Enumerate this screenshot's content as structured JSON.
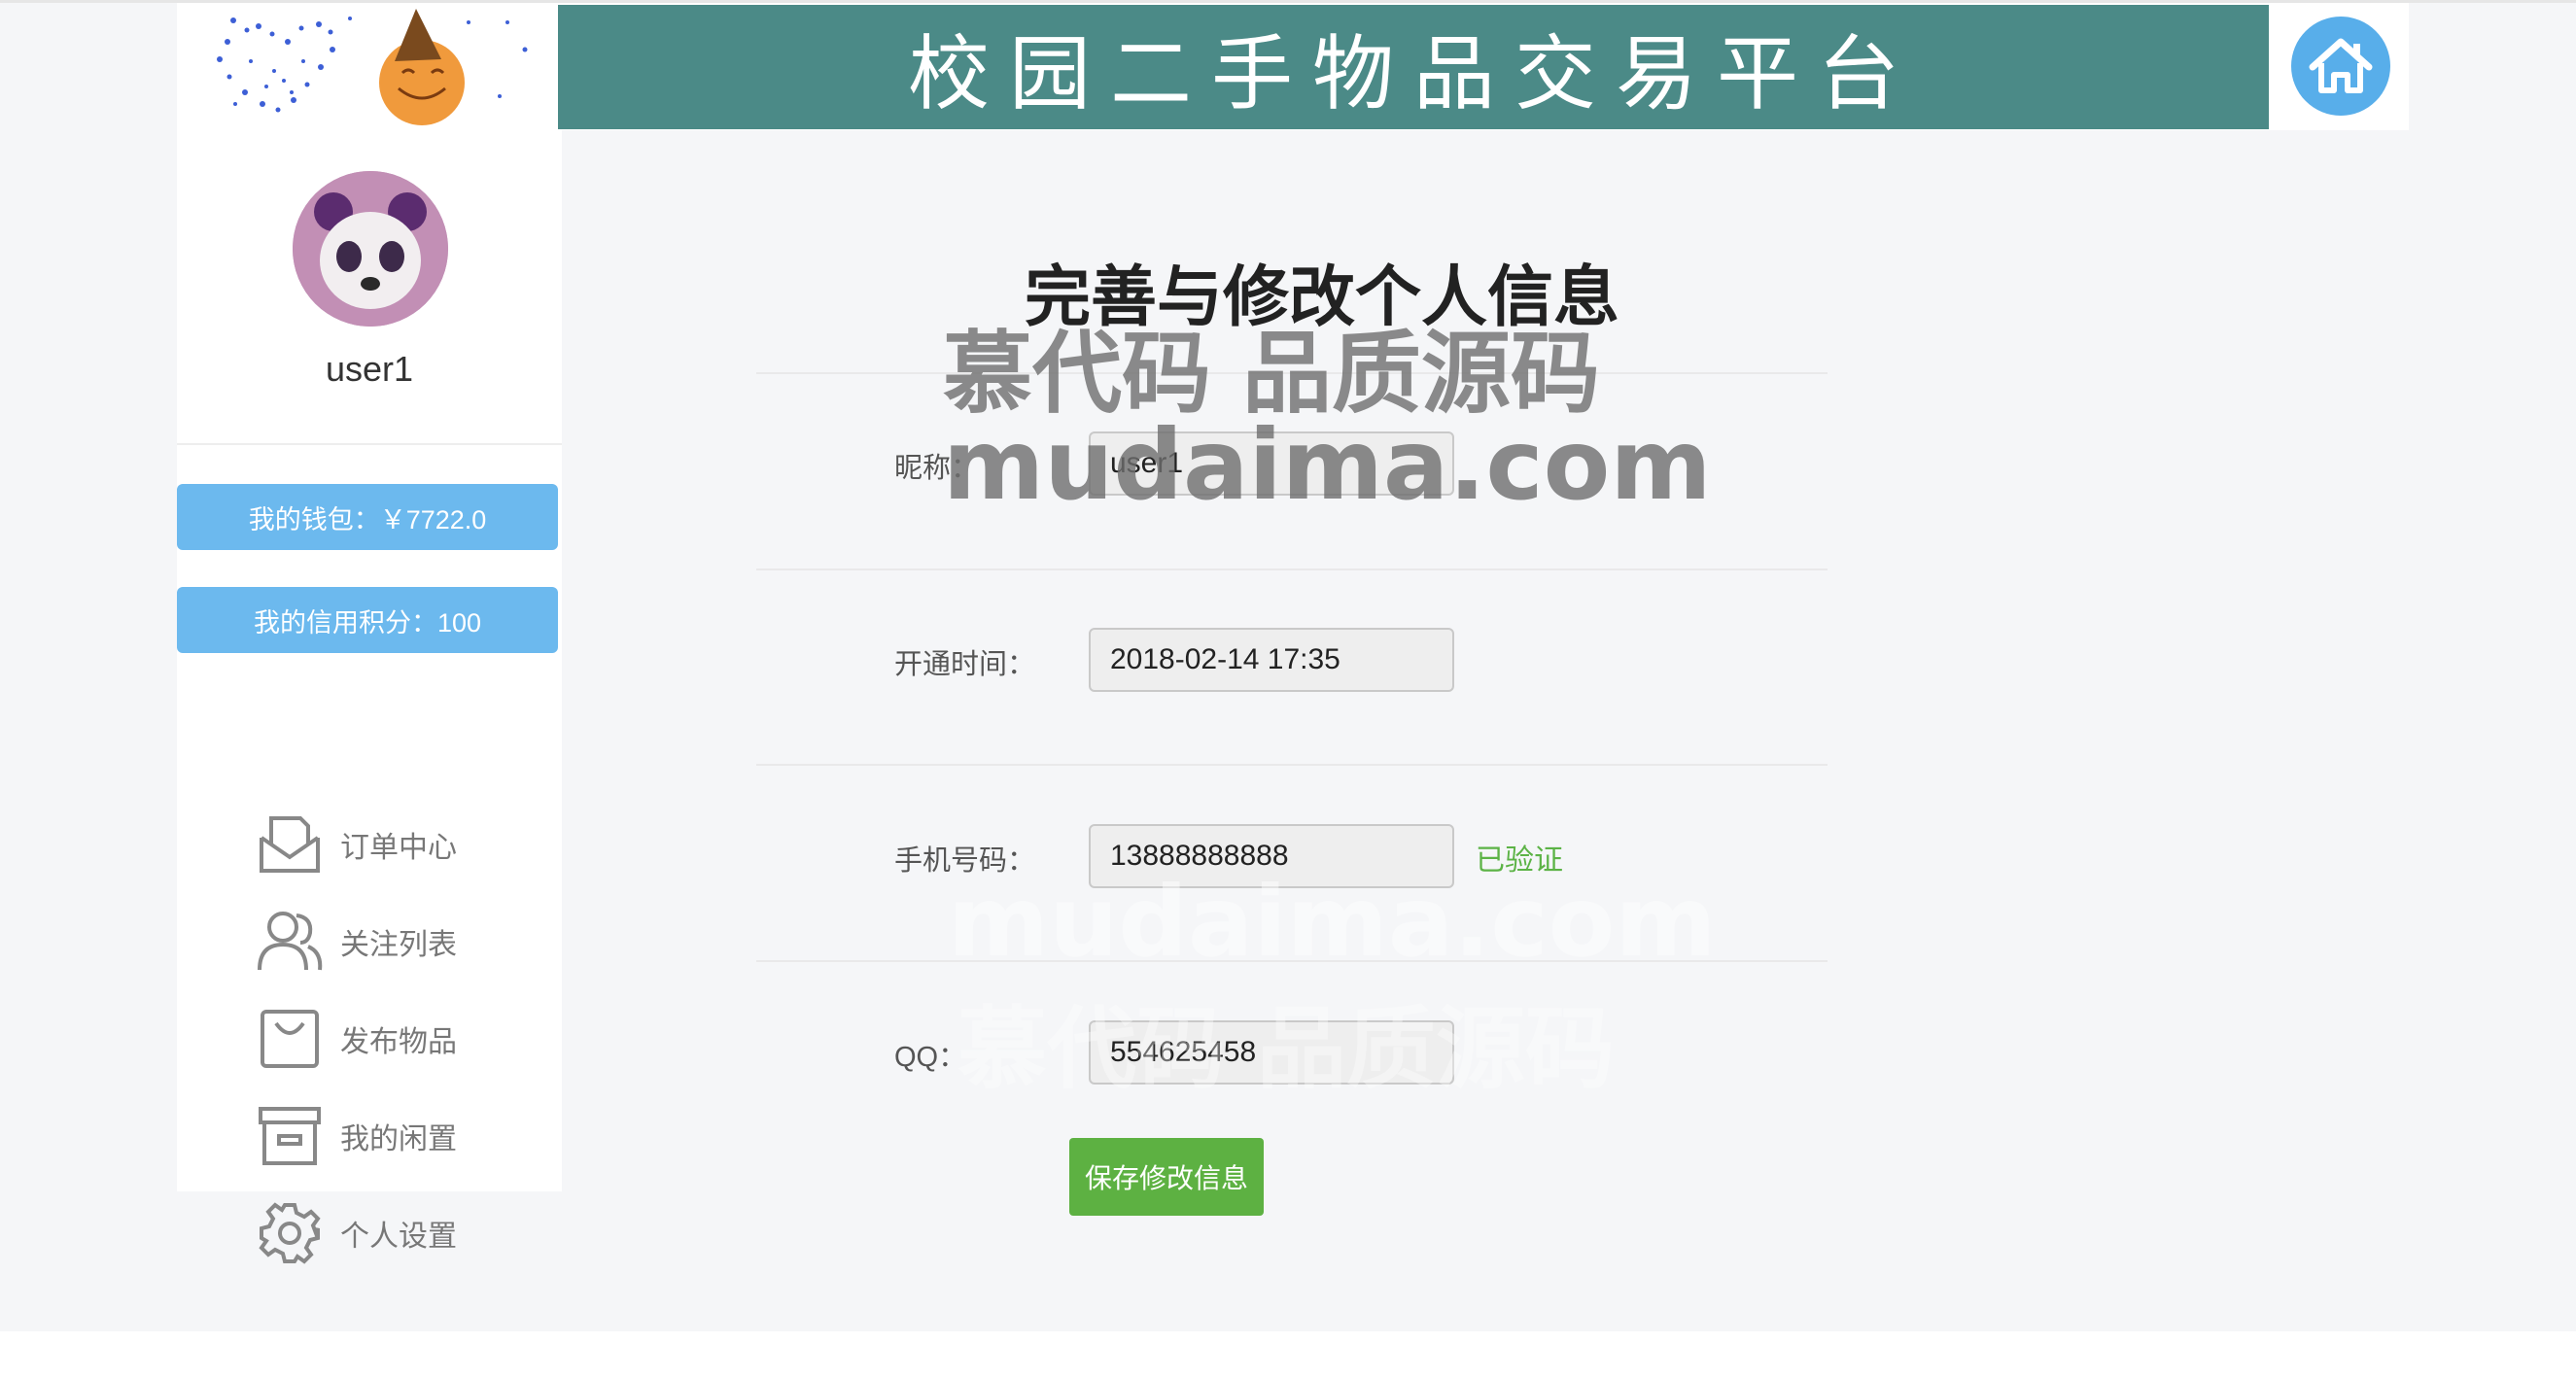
{
  "header": {
    "banner_title": "校园二手物品交易平台",
    "home_icon": "home-icon"
  },
  "sidebar": {
    "username": "user1",
    "wallet_label": "我的钱包：￥7722.0",
    "credit_label": "我的信用积分：100",
    "menu": [
      {
        "label": "订单中心",
        "icon": "envelope-icon"
      },
      {
        "label": "关注列表",
        "icon": "users-icon"
      },
      {
        "label": "发布物品",
        "icon": "bag-icon"
      },
      {
        "label": "我的闲置",
        "icon": "archive-box-icon"
      },
      {
        "label": "个人设置",
        "icon": "gear-icon"
      }
    ]
  },
  "main": {
    "title": "完善与修改个人信息",
    "fields": {
      "nickname": {
        "label": "昵称：",
        "value": "user1"
      },
      "open_time": {
        "label": "开通时间：",
        "value": "2018-02-14 17:35"
      },
      "phone": {
        "label": "手机号码：",
        "value": "13888888888",
        "status": "已验证"
      },
      "qq": {
        "label": "QQ：",
        "value": "554625458"
      }
    },
    "save_label": "保存修改信息"
  },
  "watermark": {
    "line1": "慕代码 品质源码",
    "line2": "mudaima.com"
  },
  "colors": {
    "banner": "#4b8a87",
    "sidebar_button": "#6cb9ee",
    "save_button": "#5db142",
    "verified": "#5cb346"
  }
}
